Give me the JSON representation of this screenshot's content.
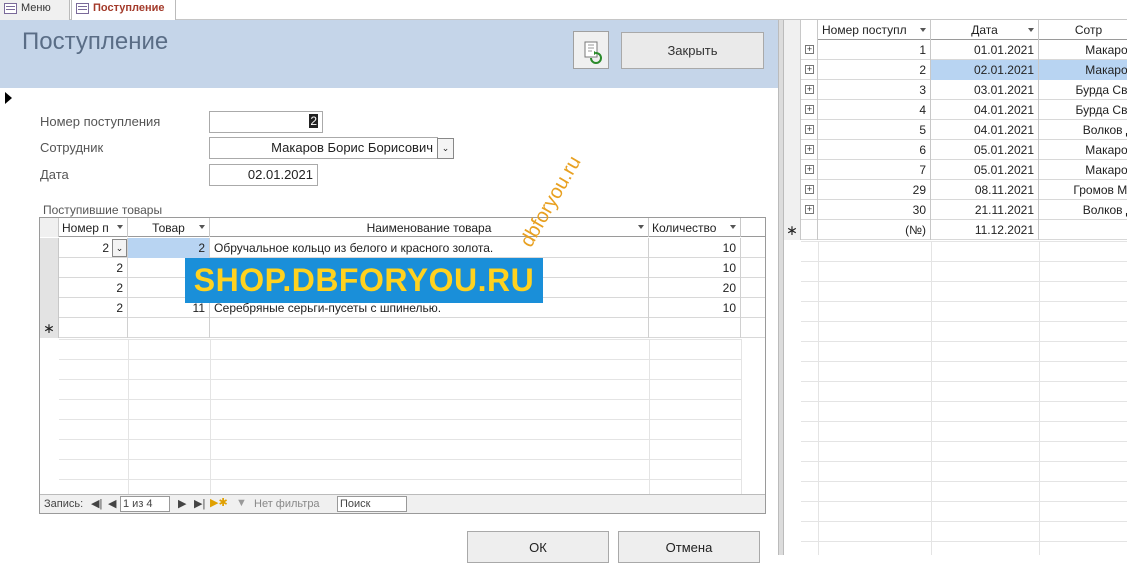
{
  "tabs": [
    {
      "label": "Меню",
      "active": false
    },
    {
      "label": "Поступление",
      "active": true
    }
  ],
  "form": {
    "title": "Поступление",
    "close_label": "Закрыть",
    "fields": {
      "number_label": "Номер поступления",
      "number_value": "2",
      "employee_label": "Сотрудник",
      "employee_value": "Макаров Борис Борисович",
      "date_label": "Дата",
      "date_value": "02.01.2021"
    },
    "subform_caption": "Поступившие товары",
    "subform": {
      "columns": [
        "Номер п",
        "Товар",
        "Наименование товара",
        "Количество"
      ],
      "rows": [
        {
          "num": "2",
          "item": "2",
          "name": "Обручальное кольцо из белого и красного золота.",
          "qty": "10"
        },
        {
          "num": "2",
          "item": "",
          "name": "",
          "qty": "10"
        },
        {
          "num": "2",
          "item": "",
          "name": "",
          "qty": "20"
        },
        {
          "num": "2",
          "item": "11",
          "name": "Серебряные серьги-пусеты с шпинелью.",
          "qty": "10"
        }
      ],
      "nav": {
        "record_label": "Запись:",
        "position": "1 из 4",
        "filter_label": "Нет фильтра",
        "search_label": "Поиск"
      }
    },
    "ok_label": "ОК",
    "cancel_label": "Отмена"
  },
  "watermark": {
    "text": "SHOP.DBFORYOU.RU",
    "rotated_text": "dbforyou.ru"
  },
  "datasheet": {
    "columns": [
      "Номер поступл",
      "Дата",
      "Сотр"
    ],
    "rows": [
      {
        "num": "1",
        "date": "01.01.2021",
        "emp": "Макаров"
      },
      {
        "num": "2",
        "date": "02.01.2021",
        "emp": "Макаров",
        "selected": true
      },
      {
        "num": "3",
        "date": "03.01.2021",
        "emp": "Бурда Све"
      },
      {
        "num": "4",
        "date": "04.01.2021",
        "emp": "Бурда Све"
      },
      {
        "num": "5",
        "date": "04.01.2021",
        "emp": "Волков Д"
      },
      {
        "num": "6",
        "date": "05.01.2021",
        "emp": "Макаров"
      },
      {
        "num": "7",
        "date": "05.01.2021",
        "emp": "Макаров"
      },
      {
        "num": "29",
        "date": "08.11.2021",
        "emp": "Громов Ма"
      },
      {
        "num": "30",
        "date": "21.11.2021",
        "emp": "Волков Д"
      }
    ],
    "new_row": {
      "num": "(№)",
      "date": "11.12.2021"
    }
  },
  "colors": {
    "header_bg": "#c5d5e9",
    "title": "#5a6d86",
    "selection": "#b8d4f2",
    "watermark_bg": "#1a8fd9",
    "watermark_fg": "#ffd21f"
  }
}
